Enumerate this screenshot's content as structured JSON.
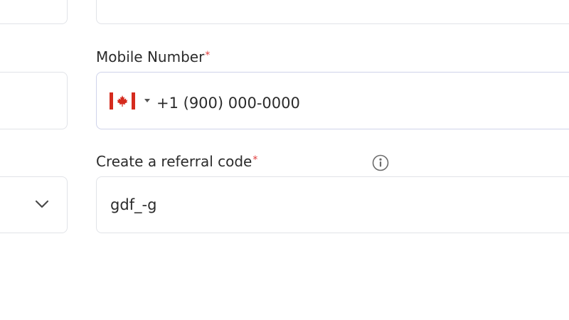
{
  "form": {
    "mobile": {
      "label": "Mobile Number",
      "required_mark": "*",
      "country_icon": "canada-flag-icon",
      "value": "+1 (900) 000-0000"
    },
    "referral": {
      "label": "Create a referral code",
      "required_mark": "*",
      "help_icon": "info-icon",
      "value": "gdf_-g"
    },
    "left_select": {
      "icon": "chevron-down-icon"
    }
  },
  "colors": {
    "required": "#e03a3a",
    "flag_red": "#d52b1e",
    "border": "#e1e3e8"
  }
}
